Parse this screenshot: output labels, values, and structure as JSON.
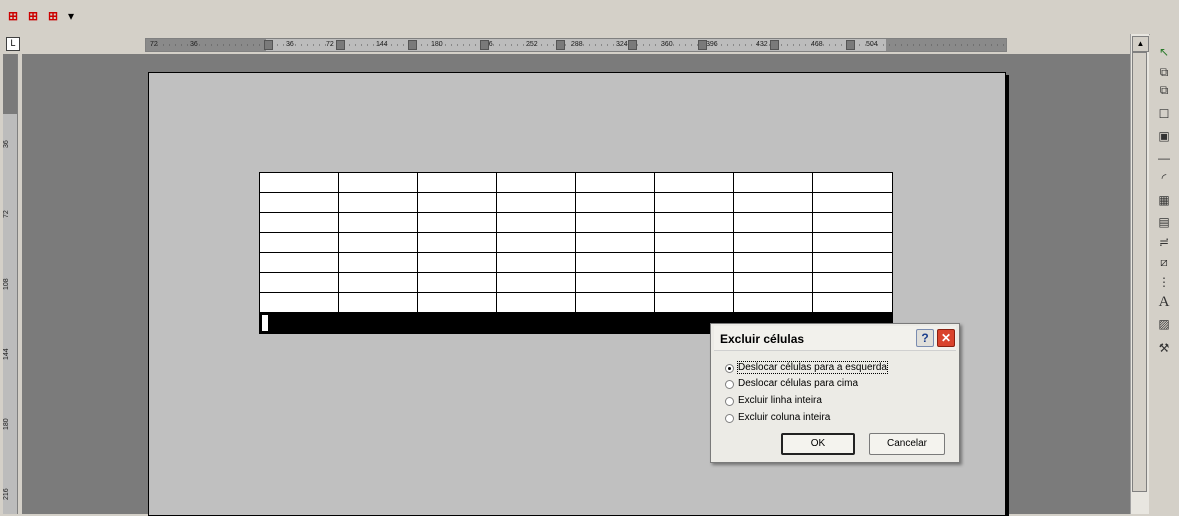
{
  "toolbar": {
    "buttons": [
      {
        "icon": "table-icon"
      },
      {
        "icon": "table-icon"
      },
      {
        "icon": "table-icon"
      }
    ]
  },
  "ruler": {
    "corner_symbol": "L",
    "horizontal_ticks": [
      "72",
      "36",
      "36",
      "72",
      "144",
      "180",
      "216",
      "252",
      "288",
      "324",
      "360",
      "396",
      "432",
      "468",
      "504"
    ],
    "vertical_ticks": [
      "36",
      "72",
      "108",
      "144",
      "180",
      "216"
    ]
  },
  "table": {
    "columns": 8,
    "rows": 7,
    "selected_row": "last"
  },
  "dialog": {
    "title": "Excluir células",
    "help_label": "?",
    "close_label": "✕",
    "options": [
      {
        "label": "Deslocar células para a esquerda",
        "selected": true
      },
      {
        "label": "Deslocar células para cima",
        "selected": false
      },
      {
        "label": "Excluir linha inteira",
        "selected": false
      },
      {
        "label": "Excluir coluna inteira",
        "selected": false
      }
    ],
    "ok_label": "OK",
    "cancel_label": "Cancelar"
  },
  "colors": {
    "workspace": "#7b7b7b",
    "page": "#c0c0c0",
    "close_button": "#d9432c"
  }
}
